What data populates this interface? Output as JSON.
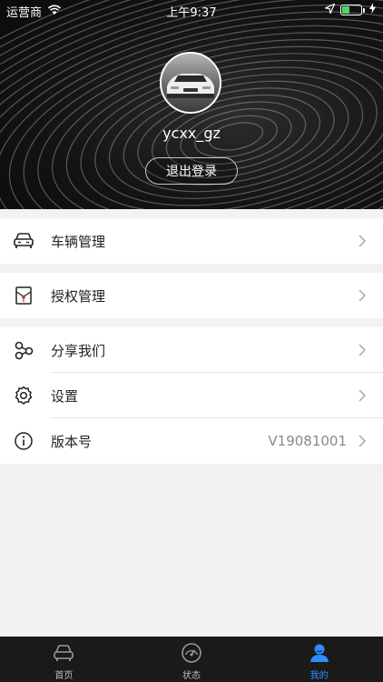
{
  "status_bar": {
    "carrier": "运营商",
    "time": "上午9:37",
    "battery_level": 0.4
  },
  "profile": {
    "username": "ycxx_gz",
    "logout_label": "退出登录"
  },
  "menu": {
    "vehicle_label": "车辆管理",
    "auth_label": "授权管理",
    "share_label": "分享我们",
    "settings_label": "设置",
    "version_label": "版本号",
    "version_value": "V19081001"
  },
  "tabs": [
    {
      "label": "首页",
      "icon": "car-icon"
    },
    {
      "label": "状态",
      "icon": "gauge-icon"
    },
    {
      "label": "我的",
      "icon": "user-icon"
    }
  ],
  "colors": {
    "accent": "#2f8cff",
    "battery": "#4cd964",
    "tabbar_bg": "#1a1a1a"
  }
}
